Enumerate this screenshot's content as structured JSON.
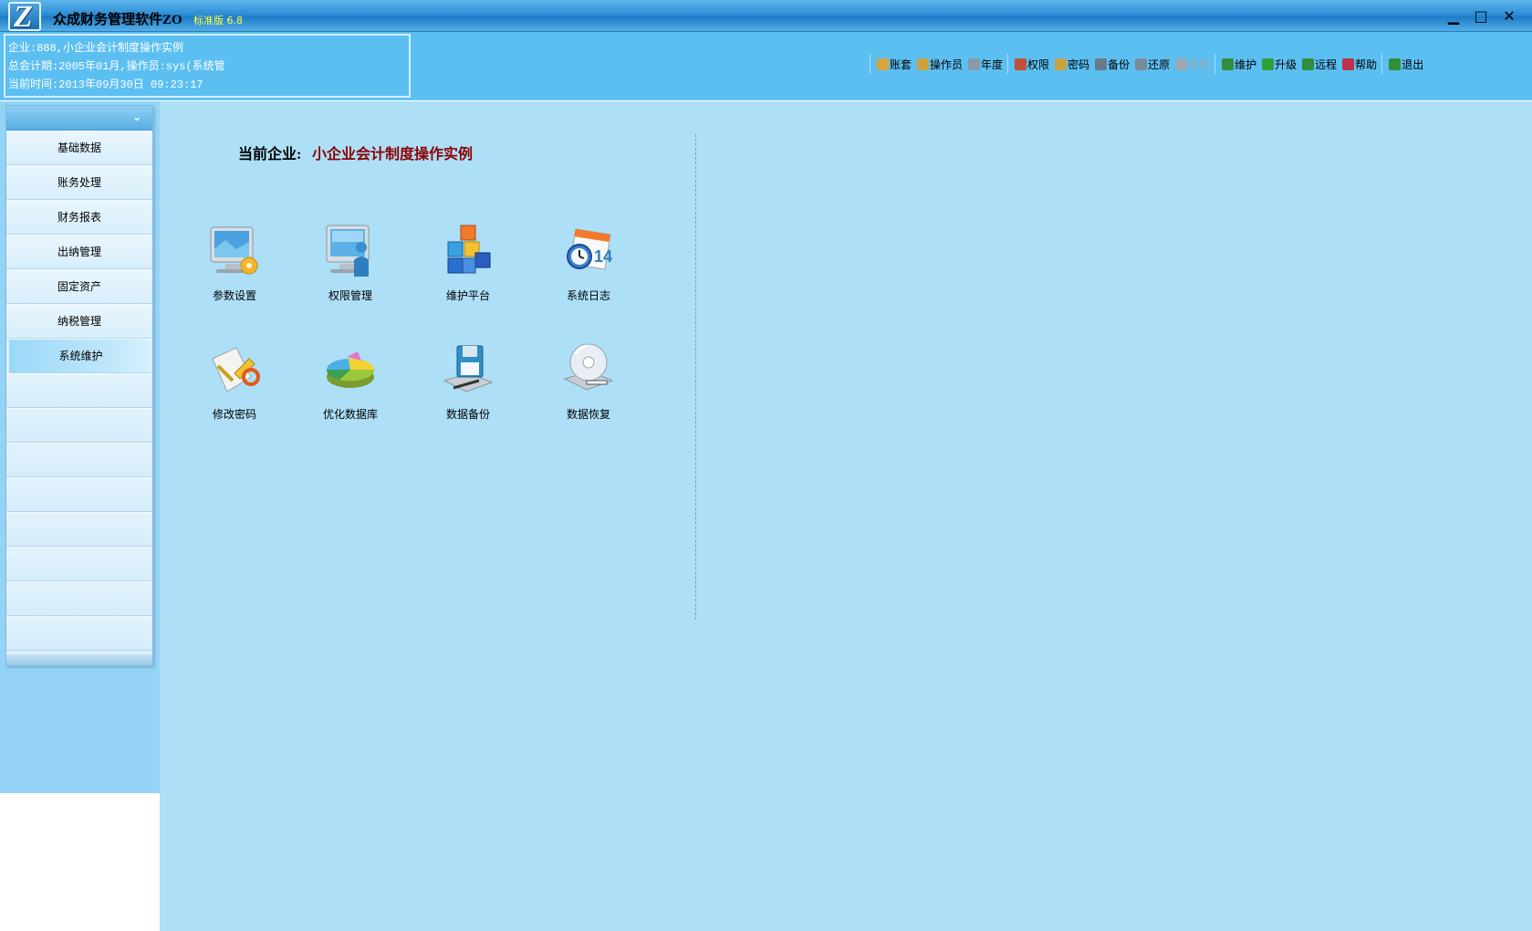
{
  "titlebar": {
    "title": "众成财务管理软件ZO",
    "edition": "标准版 6.8",
    "logo_letter": "Z",
    "min_label": "▁",
    "max_label": "□",
    "close_label": "✕"
  },
  "info": {
    "company_line": "企业:888,小企业会计制度操作实例",
    "period_line": "总会计期:2005年01月,操作员:sys(系统管",
    "time_line": "当前时间:2013年09月30日   09:23:17"
  },
  "toolbar": {
    "items": [
      {
        "label": "账套",
        "icon": "ledger-icon",
        "color": "#d9a43a"
      },
      {
        "label": "操作员",
        "icon": "operator-icon",
        "color": "#c9a23e"
      },
      {
        "label": "年度",
        "icon": "year-icon",
        "color": "#8a9aa6"
      },
      {
        "label": "权限",
        "icon": "permission-icon",
        "color": "#c0503a"
      },
      {
        "label": "密码",
        "icon": "key-icon",
        "color": "#c9a23e"
      },
      {
        "label": "备份",
        "icon": "backup-icon",
        "color": "#6c7a88"
      },
      {
        "label": "还原",
        "icon": "restore-icon",
        "color": "#7c8a98"
      },
      {
        "label": "参数",
        "icon": "params-icon",
        "color": "#9aa9b3"
      },
      {
        "label": "维护",
        "icon": "globe-icon",
        "color": "#2f8f3a"
      },
      {
        "label": "升级",
        "icon": "check-icon",
        "color": "#2fa03a"
      },
      {
        "label": "远程",
        "icon": "globe-icon",
        "color": "#2f8f3a"
      },
      {
        "label": "帮助",
        "icon": "help-icon",
        "color": "#c0304a"
      },
      {
        "label": "退出",
        "icon": "exit-icon",
        "color": "#2f8f3a"
      }
    ]
  },
  "sidebar": {
    "collapse_glyph": "⌄",
    "items": [
      {
        "label": "基础数据"
      },
      {
        "label": "账务处理"
      },
      {
        "label": "财务报表"
      },
      {
        "label": "出纳管理"
      },
      {
        "label": "固定资产"
      },
      {
        "label": "纳税管理"
      },
      {
        "label": "系统维护",
        "active": true
      }
    ],
    "empty_rows": 8
  },
  "main": {
    "company_label": "当前企业:",
    "company_name": "小企业会计制度操作实例",
    "tiles": [
      {
        "label": "参数设置",
        "icon": "monitor-settings-icon"
      },
      {
        "label": "权限管理",
        "icon": "monitor-user-icon"
      },
      {
        "label": "维护平台",
        "icon": "cubes-icon"
      },
      {
        "label": "系统日志",
        "icon": "calendar-clock-icon"
      },
      {
        "label": "修改密码",
        "icon": "password-key-icon"
      },
      {
        "label": "优化数据库",
        "icon": "pie-chart-icon"
      },
      {
        "label": "数据备份",
        "icon": "floppy-backup-icon"
      },
      {
        "label": "数据恢复",
        "icon": "disc-restore-icon"
      }
    ]
  }
}
